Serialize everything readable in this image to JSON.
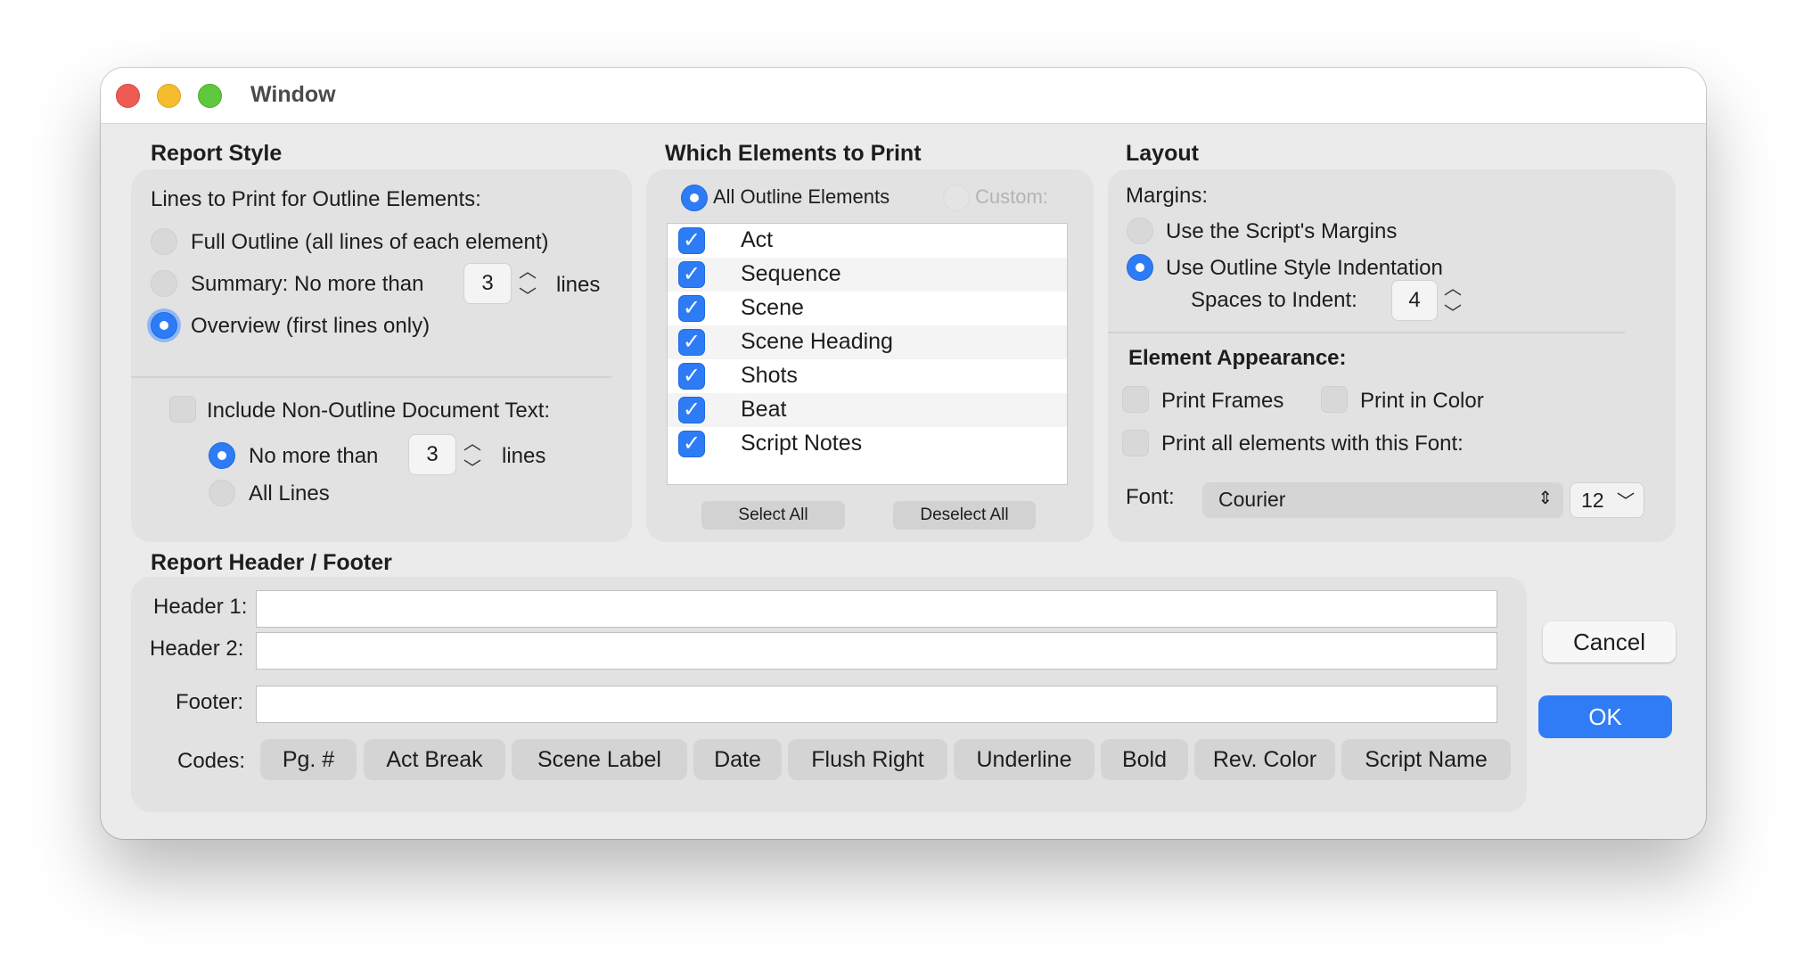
{
  "window": {
    "title": "Window"
  },
  "report_style": {
    "title": "Report Style",
    "lines_label": "Lines to Print for Outline Elements:",
    "full_outline": "Full Outline (all lines of each element)",
    "summary_prefix": "Summary:  No more than",
    "summary_value": "3",
    "summary_suffix": "lines",
    "overview": "Overview (first lines only)",
    "include_non_outline": "Include Non-Outline Document Text:",
    "no_more_than": "No more than",
    "no_more_than_value": "3",
    "no_more_than_suffix": "lines",
    "all_lines": "All Lines",
    "selected": "overview"
  },
  "which_elements": {
    "title": "Which Elements to Print",
    "all_outline": "All Outline Elements",
    "custom": "Custom:",
    "items": [
      {
        "label": "Act",
        "checked": true
      },
      {
        "label": "Sequence",
        "checked": true
      },
      {
        "label": "Scene",
        "checked": true
      },
      {
        "label": "Scene Heading",
        "checked": true
      },
      {
        "label": "Shots",
        "checked": true
      },
      {
        "label": "Beat",
        "checked": true
      },
      {
        "label": "Script Notes",
        "checked": true
      }
    ],
    "select_all": "Select All",
    "deselect_all": "Deselect All"
  },
  "layout": {
    "title": "Layout",
    "margins_label": "Margins:",
    "use_script_margins": "Use the Script's Margins",
    "use_outline_indent": "Use Outline Style Indentation",
    "spaces_label": "Spaces to Indent:",
    "spaces_value": "4",
    "element_appearance": "Element Appearance:",
    "print_frames": "Print Frames",
    "print_in_color": "Print in Color",
    "print_all_font": "Print all elements with this Font:",
    "font_label": "Font:",
    "font_value": "Courier",
    "font_size": "12"
  },
  "header_footer": {
    "title": "Report Header / Footer",
    "header1_label": "Header 1:",
    "header2_label": "Header 2:",
    "footer_label": "Footer:",
    "header1_value": "",
    "header2_value": "",
    "footer_value": "",
    "codes_label": "Codes:",
    "codes": [
      "Pg. #",
      "Act Break",
      "Scene Label",
      "Date",
      "Flush Right",
      "Underline",
      "Bold",
      "Rev. Color",
      "Script Name"
    ]
  },
  "buttons": {
    "cancel": "Cancel",
    "ok": "OK"
  },
  "colors": {
    "accent": "#2f7cf6",
    "window_bg": "#ebebeb",
    "panel_bg": "#e2e2e2"
  }
}
